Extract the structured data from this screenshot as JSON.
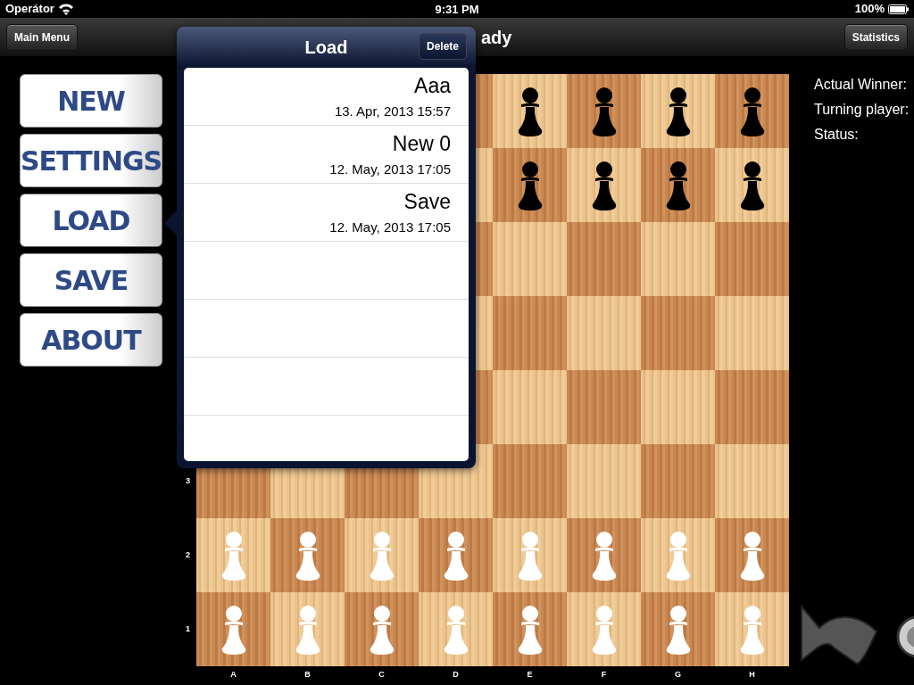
{
  "status_bar": {
    "carrier": "Operátor",
    "time": "9:31 PM",
    "battery": "100%"
  },
  "nav": {
    "left_button": "Main Menu",
    "title": "ady",
    "right_button": "Statistics"
  },
  "menu": [
    {
      "label": "NEW",
      "selected": false
    },
    {
      "label": "SETTINGS",
      "selected": false
    },
    {
      "label": "LOAD",
      "selected": true
    },
    {
      "label": "SAVE",
      "selected": false
    },
    {
      "label": "ABOUT",
      "selected": false
    }
  ],
  "popover": {
    "title": "Load",
    "button": "Delete",
    "rows": [
      {
        "name": "Aaa",
        "date": "13. Apr, 2013 15:57"
      },
      {
        "name": "New 0",
        "date": "12. May, 2013 17:05"
      },
      {
        "name": "Save",
        "date": "12. May, 2013 17:05"
      }
    ]
  },
  "board": {
    "rank_labels": [
      "3",
      "2",
      "1"
    ],
    "file_labels": [
      "A",
      "B",
      "C",
      "D",
      "E",
      "F",
      "G",
      "H"
    ],
    "rows": [
      {
        "squares": [
          {
            "kind": "covered"
          },
          {
            "kind": "covered"
          },
          {
            "kind": "covered"
          },
          {
            "kind": "covered"
          },
          {
            "kind": "black-pawn"
          },
          {
            "kind": "black-pawn"
          },
          {
            "kind": "black-pawn"
          },
          {
            "kind": "black-pawn"
          }
        ]
      },
      {
        "squares": [
          {
            "kind": "covered"
          },
          {
            "kind": "covered"
          },
          {
            "kind": "covered"
          },
          {
            "kind": "covered"
          },
          {
            "kind": "black-pawn"
          },
          {
            "kind": "black-pawn"
          },
          {
            "kind": "black-pawn"
          },
          {
            "kind": "black-pawn"
          }
        ]
      },
      {
        "squares": [
          {
            "kind": "covered"
          },
          {
            "kind": "covered"
          },
          {
            "kind": "covered"
          },
          {
            "kind": "covered"
          },
          {
            "kind": "empty"
          },
          {
            "kind": "empty"
          },
          {
            "kind": "empty"
          },
          {
            "kind": "empty"
          }
        ]
      },
      {
        "squares": [
          {
            "kind": "covered"
          },
          {
            "kind": "covered"
          },
          {
            "kind": "covered"
          },
          {
            "kind": "covered"
          },
          {
            "kind": "empty"
          },
          {
            "kind": "empty"
          },
          {
            "kind": "empty"
          },
          {
            "kind": "empty"
          }
        ]
      },
      {
        "squares": [
          {
            "kind": "covered"
          },
          {
            "kind": "covered"
          },
          {
            "kind": "covered"
          },
          {
            "kind": "covered"
          },
          {
            "kind": "empty"
          },
          {
            "kind": "empty"
          },
          {
            "kind": "empty"
          },
          {
            "kind": "empty"
          }
        ]
      },
      {
        "squares": [
          {
            "kind": "empty"
          },
          {
            "kind": "empty"
          },
          {
            "kind": "empty"
          },
          {
            "kind": "empty"
          },
          {
            "kind": "empty"
          },
          {
            "kind": "empty"
          },
          {
            "kind": "empty"
          },
          {
            "kind": "empty"
          }
        ]
      },
      {
        "squares": [
          {
            "kind": "white-pawn"
          },
          {
            "kind": "white-pawn"
          },
          {
            "kind": "white-pawn"
          },
          {
            "kind": "white-pawn"
          },
          {
            "kind": "white-pawn"
          },
          {
            "kind": "white-pawn"
          },
          {
            "kind": "white-pawn"
          },
          {
            "kind": "white-pawn"
          }
        ]
      },
      {
        "squares": [
          {
            "kind": "white-pawn"
          },
          {
            "kind": "white-pawn"
          },
          {
            "kind": "white-pawn"
          },
          {
            "kind": "white-pawn"
          },
          {
            "kind": "white-pawn"
          },
          {
            "kind": "white-pawn"
          },
          {
            "kind": "white-pawn"
          },
          {
            "kind": "white-pawn"
          }
        ]
      }
    ]
  },
  "info": [
    "Actual Winner:",
    "Turning player:",
    "Status:"
  ]
}
